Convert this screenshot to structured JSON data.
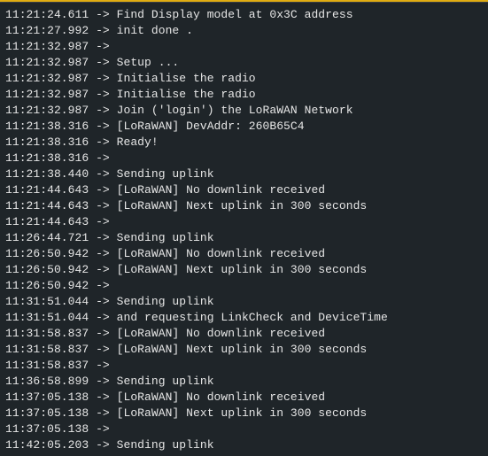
{
  "monitor": {
    "accent_color": "#e0ac12",
    "separator": " -> ",
    "lines": [
      {
        "time": "11:21:24.611",
        "text": "Find Display model at 0x3C address"
      },
      {
        "time": "11:21:27.992",
        "text": "init done ."
      },
      {
        "time": "11:21:32.987",
        "text": ""
      },
      {
        "time": "11:21:32.987",
        "text": "Setup ..."
      },
      {
        "time": "11:21:32.987",
        "text": "Initialise the radio"
      },
      {
        "time": "11:21:32.987",
        "text": "Initialise the radio"
      },
      {
        "time": "11:21:32.987",
        "text": "Join ('login') the LoRaWAN Network"
      },
      {
        "time": "11:21:38.316",
        "text": "[LoRaWAN] DevAddr: 260B65C4"
      },
      {
        "time": "11:21:38.316",
        "text": "Ready!"
      },
      {
        "time": "11:21:38.316",
        "text": ""
      },
      {
        "time": "11:21:38.440",
        "text": "Sending uplink"
      },
      {
        "time": "11:21:44.643",
        "text": "[LoRaWAN] No downlink received"
      },
      {
        "time": "11:21:44.643",
        "text": "[LoRaWAN] Next uplink in 300 seconds"
      },
      {
        "time": "11:21:44.643",
        "text": ""
      },
      {
        "time": "11:26:44.721",
        "text": "Sending uplink"
      },
      {
        "time": "11:26:50.942",
        "text": "[LoRaWAN] No downlink received"
      },
      {
        "time": "11:26:50.942",
        "text": "[LoRaWAN] Next uplink in 300 seconds"
      },
      {
        "time": "11:26:50.942",
        "text": ""
      },
      {
        "time": "11:31:51.044",
        "text": "Sending uplink"
      },
      {
        "time": "11:31:51.044",
        "text": "and requesting LinkCheck and DeviceTime"
      },
      {
        "time": "11:31:58.837",
        "text": "[LoRaWAN] No downlink received"
      },
      {
        "time": "11:31:58.837",
        "text": "[LoRaWAN] Next uplink in 300 seconds"
      },
      {
        "time": "11:31:58.837",
        "text": ""
      },
      {
        "time": "11:36:58.899",
        "text": "Sending uplink"
      },
      {
        "time": "11:37:05.138",
        "text": "[LoRaWAN] No downlink received"
      },
      {
        "time": "11:37:05.138",
        "text": "[LoRaWAN] Next uplink in 300 seconds"
      },
      {
        "time": "11:37:05.138",
        "text": ""
      },
      {
        "time": "11:42:05.203",
        "text": "Sending uplink"
      }
    ]
  }
}
